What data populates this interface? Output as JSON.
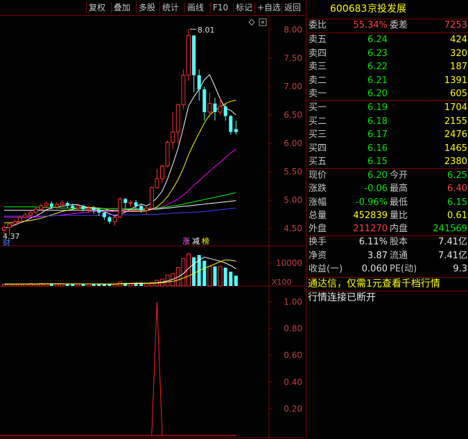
{
  "toolbar": {
    "buttons": [
      "复权",
      "叠加",
      "多股",
      "统计",
      "画线",
      "F10",
      "标记",
      "+自选",
      "返回"
    ]
  },
  "quote": {
    "code": "600683",
    "name": "京投发展",
    "weibi_label": "委比",
    "weibi": "55.34%",
    "weicha_label": "委差",
    "weicha": "7253",
    "sell": [
      {
        "label": "卖五",
        "price": "6.24",
        "vol": "424"
      },
      {
        "label": "卖四",
        "price": "6.23",
        "vol": "320"
      },
      {
        "label": "卖三",
        "price": "6.22",
        "vol": "187"
      },
      {
        "label": "卖二",
        "price": "6.21",
        "vol": "1391"
      },
      {
        "label": "卖一",
        "price": "6.20",
        "vol": "605"
      }
    ],
    "buy": [
      {
        "label": "买一",
        "price": "6.19",
        "vol": "1704"
      },
      {
        "label": "买二",
        "price": "6.18",
        "vol": "2155"
      },
      {
        "label": "买三",
        "price": "6.17",
        "vol": "2476"
      },
      {
        "label": "买四",
        "price": "6.16",
        "vol": "1465"
      },
      {
        "label": "买五",
        "price": "6.15",
        "vol": "2380"
      }
    ],
    "stats": [
      {
        "l1": "现价",
        "v1": "6.20",
        "l2": "今开",
        "v2": "6.25"
      },
      {
        "l1": "涨跌",
        "v1": "-0.06",
        "l2": "最高",
        "v2": "6.40"
      },
      {
        "l1": "涨幅",
        "v1": "-0.96%",
        "l2": "最低",
        "v2": "6.15"
      },
      {
        "l1": "总量",
        "v1": "452839",
        "l2": "量比",
        "v2": "0.61"
      },
      {
        "l1": "外盘",
        "v1": "211270",
        "l2": "内盘",
        "v2": "241569"
      }
    ],
    "stats2": [
      {
        "l1": "换手",
        "v1": "6.11%",
        "l2": "股本",
        "v2": "7.41亿"
      },
      {
        "l1": "净资",
        "v1": "3.87",
        "l2": "流通",
        "v2": "7.41亿"
      },
      {
        "l1": "收益(一)",
        "v1": "0.060",
        "l2": "PE(动)",
        "v2": "9.3"
      }
    ],
    "notice": "通达信，仅需1元查看千档行情",
    "status": "行情连接已断开"
  },
  "chart_data": [
    {
      "type": "candlestick",
      "yticks": [
        "8.00",
        "7.50",
        "7.00",
        "6.50",
        "6.00",
        "5.50",
        "5.00",
        "4.50"
      ],
      "ylim": [
        4.4,
        8.1
      ],
      "annotations": {
        "high": "8.01",
        "low": "4.37",
        "left_tag": "财",
        "tags": [
          "涨",
          "减",
          "榜"
        ]
      },
      "candles": [
        {
          "o": 4.47,
          "c": 4.52,
          "h": 4.56,
          "l": 4.4
        },
        {
          "o": 4.52,
          "c": 4.58,
          "h": 4.6,
          "l": 4.37
        },
        {
          "o": 4.58,
          "c": 4.62,
          "h": 4.66,
          "l": 4.55
        },
        {
          "o": 4.62,
          "c": 4.7,
          "h": 4.72,
          "l": 4.6
        },
        {
          "o": 4.7,
          "c": 4.74,
          "h": 4.78,
          "l": 4.68
        },
        {
          "o": 4.74,
          "c": 4.78,
          "h": 4.82,
          "l": 4.7
        },
        {
          "o": 4.78,
          "c": 4.84,
          "h": 4.88,
          "l": 4.76
        },
        {
          "o": 4.84,
          "c": 4.9,
          "h": 4.94,
          "l": 4.8
        },
        {
          "o": 4.9,
          "c": 4.94,
          "h": 4.98,
          "l": 4.86
        },
        {
          "o": 4.94,
          "c": 4.88,
          "h": 4.98,
          "l": 4.84
        },
        {
          "o": 4.88,
          "c": 4.92,
          "h": 4.96,
          "l": 4.84
        },
        {
          "o": 4.92,
          "c": 4.95,
          "h": 5.0,
          "l": 4.88
        },
        {
          "o": 4.95,
          "c": 4.9,
          "h": 4.98,
          "l": 4.86
        },
        {
          "o": 4.9,
          "c": 4.86,
          "h": 4.94,
          "l": 4.82
        },
        {
          "o": 4.86,
          "c": 4.9,
          "h": 4.94,
          "l": 4.82
        },
        {
          "o": 4.9,
          "c": 4.84,
          "h": 4.92,
          "l": 4.8
        },
        {
          "o": 4.84,
          "c": 4.86,
          "h": 4.9,
          "l": 4.78
        },
        {
          "o": 4.86,
          "c": 4.82,
          "h": 4.9,
          "l": 4.76
        },
        {
          "o": 4.82,
          "c": 4.78,
          "h": 4.86,
          "l": 4.72
        },
        {
          "o": 4.78,
          "c": 4.7,
          "h": 4.8,
          "l": 4.65
        },
        {
          "o": 4.7,
          "c": 4.62,
          "h": 4.72,
          "l": 4.58
        },
        {
          "o": 4.62,
          "c": 4.7,
          "h": 4.74,
          "l": 4.55
        },
        {
          "o": 4.7,
          "c": 5.02,
          "h": 5.05,
          "l": 4.68
        },
        {
          "o": 5.02,
          "c": 4.95,
          "h": 5.04,
          "l": 4.86
        },
        {
          "o": 4.95,
          "c": 4.96,
          "h": 5.0,
          "l": 4.88
        },
        {
          "o": 4.96,
          "c": 4.9,
          "h": 5.0,
          "l": 4.84
        },
        {
          "o": 4.9,
          "c": 4.82,
          "h": 4.92,
          "l": 4.78
        },
        {
          "o": 4.82,
          "c": 4.86,
          "h": 4.9,
          "l": 4.76
        },
        {
          "o": 4.86,
          "c": 5.22,
          "h": 5.24,
          "l": 4.84
        },
        {
          "o": 5.22,
          "c": 5.38,
          "h": 5.55,
          "l": 5.2
        },
        {
          "o": 5.38,
          "c": 5.6,
          "h": 5.62,
          "l": 5.3
        },
        {
          "o": 5.6,
          "c": 6.02,
          "h": 6.05,
          "l": 5.58
        },
        {
          "o": 6.02,
          "c": 6.2,
          "h": 6.55,
          "l": 5.9
        },
        {
          "o": 6.2,
          "c": 6.68,
          "h": 6.7,
          "l": 6.0
        },
        {
          "o": 6.68,
          "c": 7.2,
          "h": 7.3,
          "l": 6.6
        },
        {
          "o": 7.2,
          "c": 7.9,
          "h": 8.01,
          "l": 7.1
        },
        {
          "o": 7.9,
          "c": 7.2,
          "h": 7.8,
          "l": 6.9
        },
        {
          "o": 7.2,
          "c": 6.95,
          "h": 7.3,
          "l": 6.75
        },
        {
          "o": 6.95,
          "c": 6.55,
          "h": 7.0,
          "l": 6.4
        },
        {
          "o": 6.55,
          "c": 6.7,
          "h": 6.9,
          "l": 6.45
        },
        {
          "o": 6.7,
          "c": 6.55,
          "h": 6.8,
          "l": 6.4
        },
        {
          "o": 6.55,
          "c": 6.65,
          "h": 6.8,
          "l": 6.5
        },
        {
          "o": 6.65,
          "c": 6.48,
          "h": 6.7,
          "l": 6.4
        },
        {
          "o": 6.48,
          "c": 6.2,
          "h": 6.5,
          "l": 6.15
        },
        {
          "o": 6.25,
          "c": 6.2,
          "h": 6.4,
          "l": 6.15
        }
      ],
      "ma": [
        {
          "name": "MA5",
          "color": "#ffffff",
          "values": [
            4.5,
            4.53,
            4.56,
            4.6,
            4.63,
            4.68,
            4.72,
            4.77,
            4.83,
            4.86,
            4.88,
            4.89,
            4.91,
            4.92,
            4.92,
            4.89,
            4.87,
            4.86,
            4.83,
            4.8,
            4.76,
            4.72,
            4.75,
            4.79,
            4.84,
            4.89,
            4.93,
            4.9,
            4.95,
            5.04,
            5.16,
            5.37,
            5.63,
            5.91,
            6.27,
            6.66,
            6.82,
            6.95,
            7.12,
            7.21,
            7.0,
            6.78,
            6.62,
            6.58,
            6.5
          ]
        },
        {
          "name": "MA10",
          "color": "#ffff00",
          "values": [
            4.6,
            4.6,
            4.61,
            4.62,
            4.63,
            4.64,
            4.66,
            4.68,
            4.71,
            4.74,
            4.77,
            4.8,
            4.82,
            4.84,
            4.86,
            4.87,
            4.87,
            4.87,
            4.86,
            4.85,
            4.82,
            4.8,
            4.8,
            4.8,
            4.8,
            4.8,
            4.8,
            4.81,
            4.84,
            4.88,
            4.96,
            5.06,
            5.2,
            5.36,
            5.56,
            5.8,
            6.0,
            6.18,
            6.36,
            6.5,
            6.58,
            6.64,
            6.7,
            6.74,
            6.76
          ]
        },
        {
          "name": "MA20",
          "color": "#ff00ff",
          "values": [
            4.7,
            4.7,
            4.7,
            4.7,
            4.7,
            4.7,
            4.7,
            4.71,
            4.72,
            4.72,
            4.73,
            4.74,
            4.75,
            4.76,
            4.77,
            4.78,
            4.79,
            4.8,
            4.8,
            4.8,
            4.8,
            4.8,
            4.8,
            4.81,
            4.81,
            4.82,
            4.82,
            4.83,
            4.84,
            4.86,
            4.88,
            4.92,
            4.97,
            5.02,
            5.09,
            5.17,
            5.26,
            5.34,
            5.43,
            5.51,
            5.59,
            5.67,
            5.75,
            5.83,
            5.9
          ]
        },
        {
          "name": "MA60",
          "color": "#00ff00",
          "values": [
            4.88,
            4.88,
            4.88,
            4.88,
            4.88,
            4.88,
            4.88,
            4.87,
            4.87,
            4.87,
            4.87,
            4.86,
            4.86,
            4.86,
            4.86,
            4.85,
            4.85,
            4.85,
            4.85,
            4.85,
            4.85,
            4.85,
            4.85,
            4.85,
            4.85,
            4.85,
            4.85,
            4.85,
            4.86,
            4.86,
            4.87,
            4.88,
            4.9,
            4.91,
            4.93,
            4.95,
            4.97,
            4.99,
            5.01,
            5.03,
            5.05,
            5.07,
            5.09,
            5.11,
            5.13
          ]
        },
        {
          "name": "MA120",
          "color": "#ffffff",
          "values": [
            4.82,
            4.82,
            4.82,
            4.82,
            4.82,
            4.82,
            4.82,
            4.82,
            4.82,
            4.82,
            4.82,
            4.82,
            4.82,
            4.82,
            4.82,
            4.82,
            4.82,
            4.82,
            4.82,
            4.82,
            4.82,
            4.82,
            4.82,
            4.83,
            4.83,
            4.83,
            4.83,
            4.83,
            4.84,
            4.84,
            4.85,
            4.86,
            4.87,
            4.88,
            4.89,
            4.9,
            4.91,
            4.92,
            4.93,
            4.94,
            4.95,
            4.96,
            4.97,
            4.98,
            4.99
          ]
        },
        {
          "name": "MA250",
          "color": "#4040ff",
          "values": [
            4.72,
            4.72,
            4.72,
            4.72,
            4.72,
            4.72,
            4.72,
            4.72,
            4.72,
            4.72,
            4.73,
            4.73,
            4.73,
            4.73,
            4.73,
            4.73,
            4.73,
            4.73,
            4.73,
            4.73,
            4.74,
            4.74,
            4.74,
            4.74,
            4.74,
            4.74,
            4.74,
            4.75,
            4.75,
            4.75,
            4.76,
            4.76,
            4.77,
            4.77,
            4.78,
            4.78,
            4.79,
            4.79,
            4.8,
            4.81,
            4.82,
            4.83,
            4.84,
            4.85,
            4.86
          ]
        }
      ]
    },
    {
      "type": "bar",
      "ytick": "10000",
      "unit": "X100",
      "ylim": [
        0,
        16000
      ],
      "values": [
        800,
        900,
        700,
        800,
        900,
        1000,
        900,
        1100,
        1000,
        900,
        800,
        1000,
        900,
        800,
        900,
        1000,
        900,
        800,
        900,
        800,
        700,
        900,
        1800,
        1300,
        1000,
        1200,
        1100,
        1000,
        1500,
        2500,
        3000,
        4800,
        5500,
        8000,
        12000,
        14000,
        12500,
        13500,
        11000,
        8500,
        8500,
        8500,
        8000,
        6200,
        4500
      ],
      "ma": [
        {
          "color": "#ffffff",
          "values": [
            800,
            820,
            820,
            820,
            840,
            860,
            860,
            900,
            940,
            980,
            960,
            940,
            920,
            900,
            880,
            900,
            900,
            880,
            880,
            860,
            840,
            830,
            1000,
            1100,
            1160,
            1240,
            1280,
            1220,
            1220,
            1440,
            1700,
            2180,
            2900,
            3900,
            5400,
            7700,
            9600,
            11200,
            12600,
            12000,
            11400,
            10800,
            10000,
            8900,
            7500
          ]
        },
        {
          "color": "#ffff00",
          "values": [
            800,
            810,
            810,
            815,
            820,
            830,
            840,
            860,
            880,
            900,
            910,
            920,
            930,
            930,
            920,
            920,
            910,
            900,
            890,
            880,
            860,
            850,
            900,
            950,
            1000,
            1060,
            1090,
            1110,
            1160,
            1290,
            1420,
            1720,
            2020,
            2600,
            3400,
            4400,
            5500,
            6700,
            7800,
            8600,
            9600,
            10600,
            11400,
            11200,
            10800
          ]
        }
      ]
    },
    {
      "type": "line",
      "yticks": [
        "1.00",
        "0.80",
        "0.60",
        "0.40",
        "0.20"
      ],
      "ylim": [
        0,
        1.1
      ],
      "values": [
        0,
        0,
        0,
        0,
        0,
        0,
        0,
        0,
        0,
        0,
        0,
        0,
        0,
        0,
        0,
        0,
        0,
        0,
        0,
        0,
        0,
        0,
        0,
        0,
        0,
        0,
        0,
        0,
        0,
        1,
        0,
        0,
        0,
        0,
        0,
        0,
        0,
        0,
        0,
        0,
        0,
        0,
        0,
        0,
        0
      ]
    }
  ]
}
